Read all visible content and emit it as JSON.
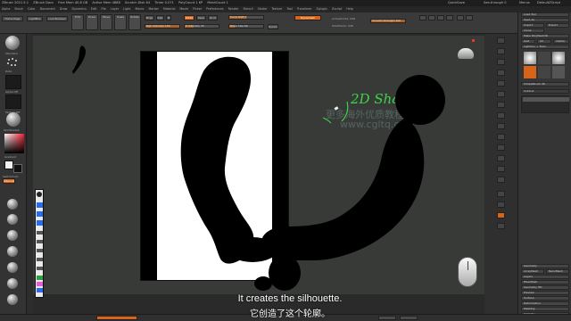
{
  "titlebar": {
    "items": [
      "ZBrush 2021.5.1",
      "ZBrush Docs",
      "Free Mem 40.8 GB",
      "Active Mem 4888",
      "Scratch Disk 64",
      "Timer 0.071",
      "PolyCount 1 KP",
      "MeshCount 1"
    ],
    "right": [
      "QuickSave",
      "See-through 0",
      "Menus",
      "DefaultZScript"
    ]
  },
  "menubar": {
    "items": [
      "Alpha",
      "Brush",
      "Color",
      "Document",
      "Draw",
      "Dynamics",
      "Edit",
      "File",
      "Layer",
      "Light",
      "Macro",
      "Marker",
      "Material",
      "Movie",
      "Picker",
      "Preferences",
      "Render",
      "Stencil",
      "Stroke",
      "Texture",
      "Tool",
      "Transform",
      "Zplugin",
      "Zscript",
      "Help"
    ]
  },
  "topshelf": {
    "home_page": "Home Page",
    "lightbox": "LightBox",
    "live_boolean": "Live Boolean",
    "edit": "Edit",
    "draw": "Draw",
    "move": "Move",
    "scale": "Scale",
    "rotate": "Rotate",
    "mrgb": "Mrgb",
    "rgb": "Rgb",
    "m": "M",
    "zadd": "Zadd",
    "zsub": "Zsub",
    "zcut": "Zcut",
    "rgb_intensity": "Rgb Intensity 100",
    "z_intensity": "Z Intensity 25",
    "focal_shift": "Focal Shift 0",
    "draw_size": "Draw Size 64",
    "dynamic": "Dynamic",
    "active_points": "ActivePoints: 948",
    "total_points": "TotalPoints: 948",
    "dynamesh": "Dynamesh",
    "smooth_strength": "Smooth Strength 100"
  },
  "left_tray": {
    "labels": [
      "Standard",
      "Dots",
      "Alpha Off",
      "Texture Off",
      "SkinShade4",
      "Gradient",
      "SwitchColor",
      "Alternate"
    ]
  },
  "right_tray": {
    "rows": [
      "Load Tool",
      "Save As",
      "Import",
      "Export",
      "Clone",
      "Make PolyMesh3D",
      "GoZ",
      "All",
      "Visible",
      "R",
      "Lightbox > Tools",
      "SimpleBrush 48",
      "Subtool",
      "Geometry",
      "ArrayMesh",
      "NanoMesh",
      "Layers",
      "FiberMesh",
      "Geometry HD",
      "Preview",
      "Surface",
      "Deformation",
      "Masking",
      "Visibility",
      "Polygroups"
    ]
  },
  "overlay": {
    "annotation": "2D Shape",
    "watermark_cn": "更多海外优质教程",
    "watermark_url": "www.cgltq.com"
  },
  "subtitles": {
    "english": "It creates the silhouette.",
    "chinese": "它创造了这个轮廓。"
  },
  "colors": {
    "accent": "#d8641a",
    "annotation": "#3fd24a",
    "background": "#383a38"
  }
}
